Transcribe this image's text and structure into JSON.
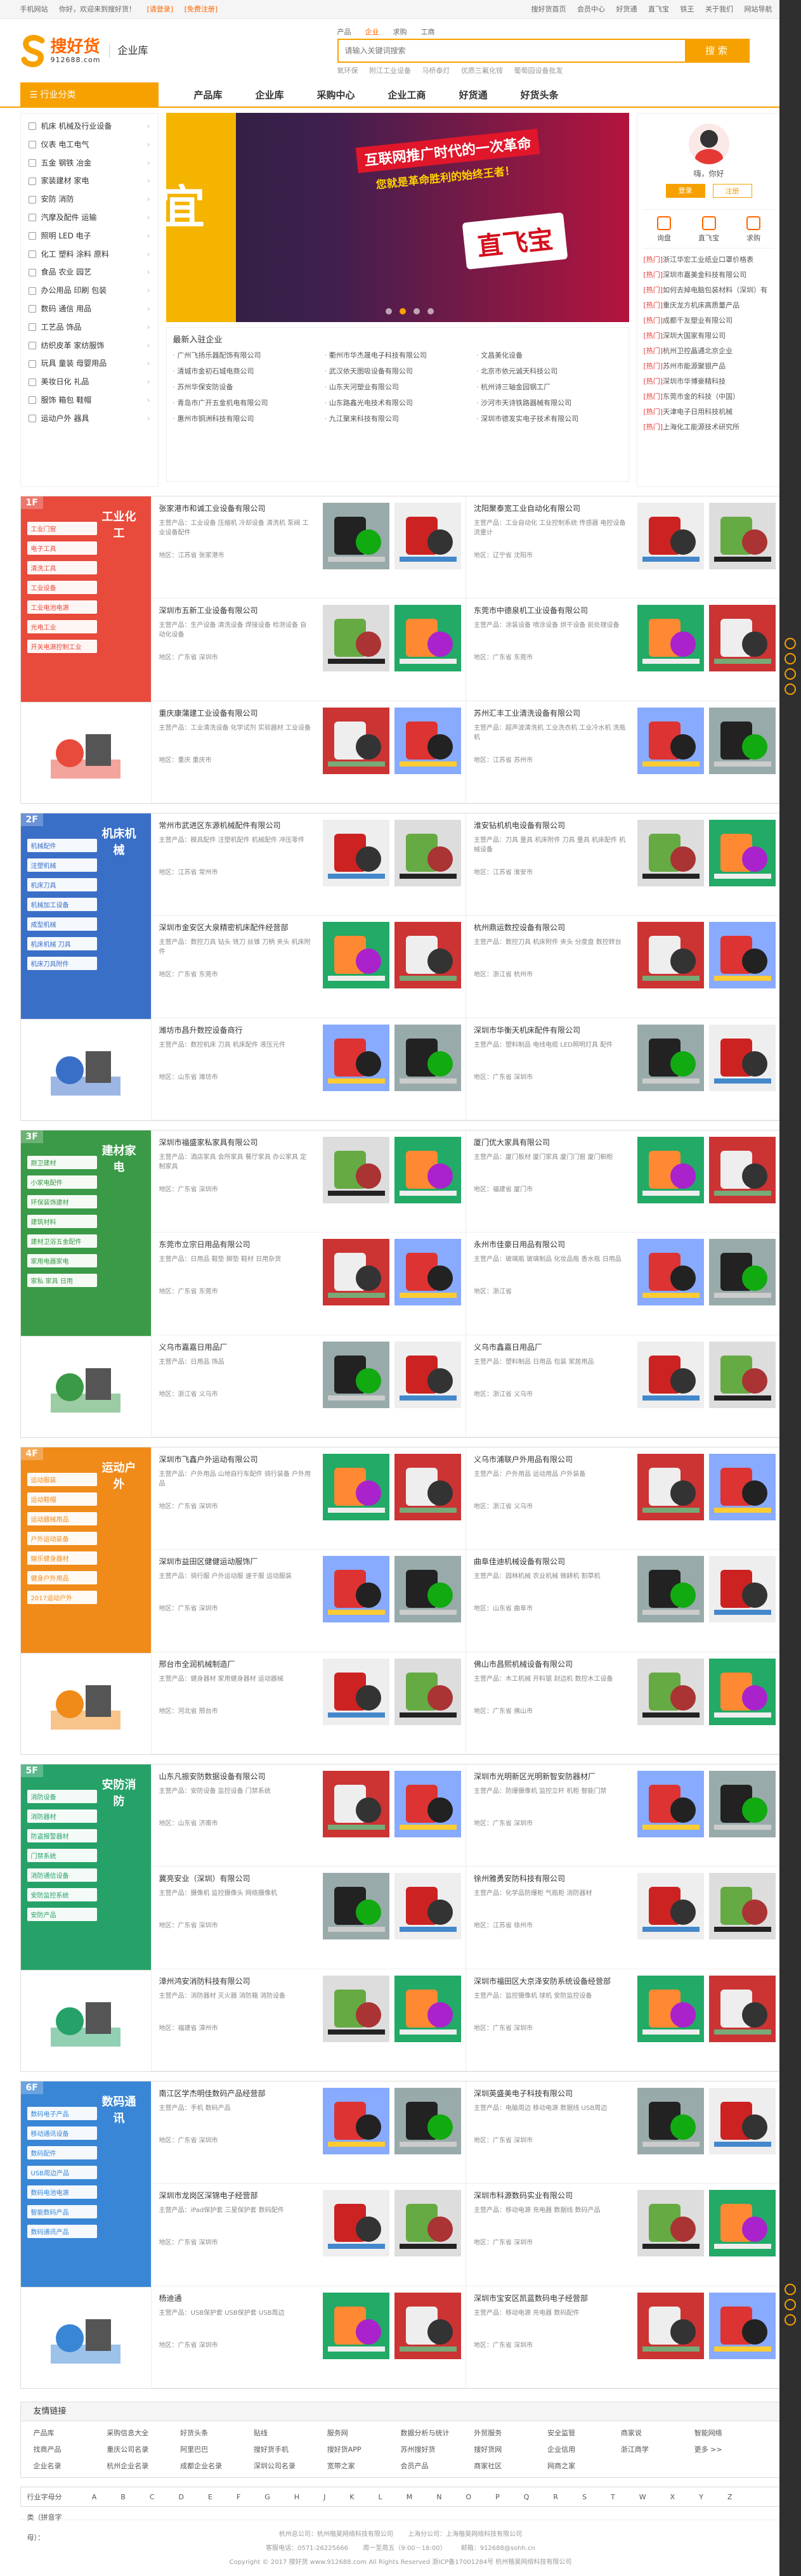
{
  "topbar": {
    "left": [
      "手机网站",
      "你好，欢迎来到搜好货！",
      "[请登录]",
      "[免费注册]"
    ],
    "right": [
      "搜好货首页",
      "会员中心",
      "好货通",
      "直飞宝",
      "铁王",
      "关于我们",
      "网站导航"
    ]
  },
  "logo": {
    "cn": "搜好货",
    "en": "912688.com",
    "sub": "企业库"
  },
  "search": {
    "tabs": [
      "产品",
      "企业",
      "求购",
      "工商"
    ],
    "active_tab": "企业",
    "placeholder": "请输入关键词搜索",
    "button": "搜 索",
    "hot": [
      "氧环保",
      "附江工业设备",
      "马桥泰灯",
      "优质三氟化铵",
      "葡萄园设备批发"
    ]
  },
  "nav": {
    "category_button": "行业分类",
    "links": [
      "产品库",
      "企业库",
      "采购中心",
      "企业工商",
      "好货通",
      "好货头条"
    ]
  },
  "categories": [
    "机床 机械及行业设备",
    "仪表 电工电气",
    "五金 钢铁 冶金",
    "家装建材 家电",
    "安防 消防",
    "汽摩及配件 运输",
    "照明 LED 电子",
    "化工 塑料 涂料 原料",
    "食品 农业 园艺",
    "办公用品 印刷 包装",
    "数码 通信 用品",
    "工艺品 饰品",
    "纺织皮革 家纺服饰",
    "玩具 童装 母婴用品",
    "美妆日化 礼品",
    "服饰 箱包 鞋帽",
    "运动户外 器具"
  ],
  "banner": {
    "left_text": "宜",
    "line1": "互联网推广时代的一次革命",
    "line2": "您就是革命胜利的始终王者！",
    "line3": "直飞宝"
  },
  "new_join": {
    "title": "最新入驻企业",
    "items": [
      "广州飞扬乐器配饰有限公司",
      "衢州市华杰晟电子科技有限公司",
      "文昌美化设备",
      "清城市金初石城电商公司",
      "武汉依天图吸设备有限公司",
      "北京市依元诚天科技公司",
      "苏州华保安防设备",
      "山东天河塑业有限公司",
      "杭州诗三轴金园钢工厂",
      "青岛市广开五金机电有限公司",
      "山东路鑫光电技术有限公司",
      "沙河市天诗铁路器械有限公司",
      "惠州市铜洲科技有限公司",
      "九江聚来科技有限公司",
      "深圳市德发实电子技术有限公司"
    ]
  },
  "user": {
    "greeting": "嗨，你好",
    "login": "登录",
    "register": "注册",
    "quick": [
      "询盘",
      "直飞宝",
      "求购"
    ],
    "news": [
      {
        "tag": "[热门]",
        "text": "浙江华宏工业纸业口罩价格表"
      },
      {
        "tag": "[热门]",
        "text": "深圳市嘉美金科技有限公司"
      },
      {
        "tag": "[热门]",
        "text": "如何去掉电脑包装材料（深圳）有"
      },
      {
        "tag": "[热门]",
        "text": "重庆龙方机床高质量产品"
      },
      {
        "tag": "[热门]",
        "text": "成都千友塑业有限公司"
      },
      {
        "tag": "[热门]",
        "text": "深圳大国家有限公司"
      },
      {
        "tag": "[热门]",
        "text": "杭州卫控晶通北京企业"
      },
      {
        "tag": "[热门]",
        "text": "苏州市能源聚银产品"
      },
      {
        "tag": "[热门]",
        "text": "深圳市华博豪精科技"
      },
      {
        "tag": "[热门]",
        "text": "东莞市金的科技（中国）"
      },
      {
        "tag": "[热门]",
        "text": "天津电子日用科技机械"
      },
      {
        "tag": "[热门]",
        "text": "上海化工能源技术研究所"
      }
    ]
  },
  "floors": [
    {
      "no": "1F",
      "title": "工业化工",
      "color": "#e84a3c",
      "tags": [
        "工业门窗",
        "电子工具",
        "清洗工具",
        "工业设备",
        "工业电池电源",
        "光电工业",
        "开关电源控制工业"
      ],
      "companies": [
        {
          "name": "张家港市和诚工业设备有限公司",
          "desc": "主营产品：工业设备 压缩机 冷却设备 清洗机 泵阀 工业设备配件",
          "addr": "地区：江苏省 张家港市"
        },
        {
          "name": "沈阳聚泰宽工业自动化有限公司",
          "desc": "主营产品：工业自动化 工业控制系统 传感器 电控设备 流量计",
          "addr": "地区：辽宁省 沈阳市"
        },
        {
          "name": "深圳市五新工业设备有限公司",
          "desc": "主营产品：生产设备 清洗设备 焊接设备 检测设备 自动化设备",
          "addr": "地区：广东省 深圳市"
        },
        {
          "name": "东莞市中德泉机工业设备有限公司",
          "desc": "主营产品：涂装设备 喷涂设备 烘干设备 前处理设备",
          "addr": "地区：广东省 东莞市"
        },
        {
          "name": "重庆康蒲建工业设备有限公司",
          "desc": "主营产品：工业清洗设备 化学试剂 实验器材 工业设备",
          "addr": "地区：重庆 重庆市"
        },
        {
          "name": "苏州汇丰工业清洗设备有限公司",
          "desc": "主营产品：超声波清洗机 工业洗衣机 工业冷水机 洗瓶机",
          "addr": "地区：江苏省 苏州市"
        }
      ]
    },
    {
      "no": "2F",
      "title": "机床机械",
      "color": "#3a6fc7",
      "tags": [
        "机械配件",
        "注塑机械",
        "机床刀具",
        "机械加工设备",
        "成型机械",
        "机床机械 刀具",
        "机床刀具附件"
      ],
      "companies": [
        {
          "name": "常州市武进区东源机械配件有限公司",
          "desc": "主营产品：模具配件 注塑机配件 机械配件 冲压零件",
          "addr": "地区：江苏省 常州市"
        },
        {
          "name": "淮安钻机机电设备有限公司",
          "desc": "主营产品：刀具 量具 机床附件 刀具 量具 机床配件 机械设备",
          "addr": "地区：江苏省 淮安市"
        },
        {
          "name": "深圳市金安区大泉精密机床配件经营部",
          "desc": "主营产品：数控刀具 钻头 铣刀 丝锥 刀柄 夹头 机床附件",
          "addr": "地区：广东省 东莞市"
        },
        {
          "name": "杭州鼎运数控设备有限公司",
          "desc": "主营产品：数控刀具 机床附件 夹头 分度盘 数控转台",
          "addr": "地区：浙江省 杭州市"
        },
        {
          "name": "潍坊市昌升数控设备商行",
          "desc": "主营产品：数控机床 刀具 机床配件 液压元件",
          "addr": "地区：山东省 潍坊市"
        },
        {
          "name": "深圳市华衡天机床配件有限公司",
          "desc": "主营产品：塑料制品 电线电缆 LED照明灯具 配件",
          "addr": "地区：广东省 深圳市"
        }
      ]
    },
    {
      "no": "3F",
      "title": "建材家电",
      "color": "#3a9a47",
      "tags": [
        "厨卫建材",
        "小家电配件",
        "环保装饰建材",
        "建筑材料",
        "建材卫浴五金配件",
        "家用电器家电",
        "家私 家具 日用"
      ],
      "companies": [
        {
          "name": "深圳市福盛家私家具有限公司",
          "desc": "主营产品：酒店家具 会所家具 餐厅家具 办公家具 定制家具",
          "addr": "地区：广东省 深圳市"
        },
        {
          "name": "厦门优大家具有限公司",
          "desc": "主营产品：厦门板材 厦门家具 厦门门窗 厦门橱柜",
          "addr": "地区：福建省 厦门市"
        },
        {
          "name": "东莞市立宗日用品有限公司",
          "desc": "主营产品：日用品 鞋垫 脚垫 鞋材 日用杂货",
          "addr": "地区：广东省 东莞市"
        },
        {
          "name": "永州市佳豪日用品有限公司",
          "desc": "主营产品：玻璃瓶 玻璃制品 化妆品瓶 香水瓶 日用品",
          "addr": "地区：浙江省"
        },
        {
          "name": "义乌市嘉嘉日用品厂",
          "desc": "主营产品：日用品 饰品",
          "addr": "地区：浙江省 义乌市"
        },
        {
          "name": "义乌市鑫嘉日用品厂",
          "desc": "主营产品：塑料制品 日用品 包装 家居用品",
          "addr": "地区：浙江省 义乌市"
        }
      ]
    },
    {
      "no": "4F",
      "title": "运动户外",
      "color": "#f08b1a",
      "tags": [
        "运动服装",
        "运动鞋帽",
        "运动器械用品",
        "户外运动装备",
        "娱乐健身器材",
        "健身户外用品",
        "2017运动户外"
      ],
      "companies": [
        {
          "name": "深圳市飞鑫户外运动有限公司",
          "desc": "主营产品：户外用品 山地自行车配件 骑行装备 户外用品",
          "addr": "地区：广东省 深圳市"
        },
        {
          "name": "义乌市浦联户外用品有限公司",
          "desc": "主营产品：户外用品 运动用品 户外装备",
          "addr": "地区：浙江省 义乌市"
        },
        {
          "name": "深圳市益田区健健运动服饰厂",
          "desc": "主营产品：骑行服 户外运动服 速干服 运动服装",
          "addr": "地区：广东省 深圳市"
        },
        {
          "name": "曲阜佳迪机械设备有限公司",
          "desc": "主营产品：园林机械 农业机械 微耕机 割草机",
          "addr": "地区：山东省 曲阜市"
        },
        {
          "name": "邢台市全润机械制造厂",
          "desc": "主营产品：健身器材 家用健身器材 运动器械",
          "addr": "地区：河北省 邢台市"
        },
        {
          "name": "佛山市昌熙机械设备有限公司",
          "desc": "主营产品：木工机械 开料锯 封边机 数控木工设备",
          "addr": "地区：广东省 佛山市"
        }
      ]
    },
    {
      "no": "5F",
      "title": "安防消防",
      "color": "#26a269",
      "tags": [
        "消防设备",
        "消防器材",
        "防盗报警器材",
        "门禁系统",
        "消防通信设备",
        "安防监控系统",
        "安防产品"
      ],
      "companies": [
        {
          "name": "山东凡振安防数据设备有限公司",
          "desc": "主营产品：安防设备 监控设备 门禁系统",
          "addr": "地区：山东省 济南市"
        },
        {
          "name": "深圳市光明新区光明新智安防器材厂",
          "desc": "主营产品：防爆摄像机 监控立杆 机柜 智能门禁",
          "addr": "地区：广东省 深圳市"
        },
        {
          "name": "冀亮安业（深圳）有限公司",
          "desc": "主营产品：摄像机 监控摄像头 网络摄像机",
          "addr": "地区：广东省 深圳市"
        },
        {
          "name": "徐州雅勇安防科技有限公司",
          "desc": "主营产品：化学品防爆柜 气瓶柜 消防器材",
          "addr": "地区：江苏省 徐州市"
        },
        {
          "name": "漳州鸿安消防科技有限公司",
          "desc": "主营产品：消防器材 灭火器 消防箱 消防设备",
          "addr": "地区：福建省 漳州市"
        },
        {
          "name": "深圳市福田区大京泽安防系统设备经营部",
          "desc": "主营产品：监控摄像机 球机 安防监控设备",
          "addr": "地区：广东省 深圳市"
        }
      ]
    },
    {
      "no": "6F",
      "title": "数码通讯",
      "color": "#3a86d6",
      "tags": [
        "数码电子产品",
        "移动通讯设备",
        "数码配件",
        "USB周边产品",
        "数码电池电源",
        "智能数码产品",
        "数码通讯产品"
      ],
      "companies": [
        {
          "name": "南江区学杰明佳数码产品经营部",
          "desc": "主营产品：手机 数码产品",
          "addr": "地区：广东省 深圳市"
        },
        {
          "name": "深圳英盛美电子科技有限公司",
          "desc": "主营产品：电脑周边 移动电源 数据线 USB周边",
          "addr": "地区：广东省 深圳市"
        },
        {
          "name": "深圳市龙岗区深锦电子经营部",
          "desc": "主营产品：iPad保护套 三星保护套 数码配件",
          "addr": "地区：广东省 深圳市"
        },
        {
          "name": "深圳市科源数码实业有限公司",
          "desc": "主营产品：移动电源 充电器 数据线 数码产品",
          "addr": "地区：广东省 深圳市"
        },
        {
          "name": "杨迪通",
          "desc": "主营产品：USB保护套 USB保护套 USB周边",
          "addr": "地区：广东省 深圳市"
        },
        {
          "name": "深圳市宝安区凯蓝数码电子经营部",
          "desc": "主营产品：移动电源 充电器 数码配件",
          "addr": "地区：广东省 深圳市"
        }
      ]
    }
  ],
  "links": {
    "title": "友情链接",
    "items": [
      "产品库",
      "采购信息大全",
      "好货头条",
      "贴线",
      "服务网",
      "数据分析与统计",
      "外贸服务",
      "安全监管",
      "商家说",
      "智能网络",
      "找商产品",
      "重庆公司名录",
      "阿里巴巴",
      "搜好货手机",
      "搜好货APP",
      "苏州搜好货",
      "搜好货网",
      "企业信用",
      "浙江商学",
      "更多 >>",
      "企业名录",
      "杭州企业名录",
      "成都企业名录",
      "深圳公司名录",
      "宽带之家",
      "会员产品",
      "商家社区",
      "网商之家",
      "",
      ""
    ]
  },
  "alpha": {
    "label": "行业字母分类（拼音字母）：",
    "letters": [
      "A",
      "B",
      "C",
      "D",
      "E",
      "F",
      "G",
      "H",
      "J",
      "K",
      "L",
      "M",
      "N",
      "O",
      "P",
      "Q",
      "R",
      "S",
      "T",
      "W",
      "X",
      "Y",
      "Z"
    ]
  },
  "footer": {
    "row1": [
      "杭州总公司：杭州楷昊网络科技有限公司",
      "上海分公司：上海楷昊网络科技有限公司"
    ],
    "row2": [
      "客服电话：0571-26225666",
      "周一至周五（9:00－18:00）",
      "邮箱：912688@sohh.cn"
    ],
    "copyright": "Copyright © 2017 搜好货 www.912688.com All Rights Reserved 浙ICP备17001284号 杭州楷昊网络科技有限公司"
  }
}
